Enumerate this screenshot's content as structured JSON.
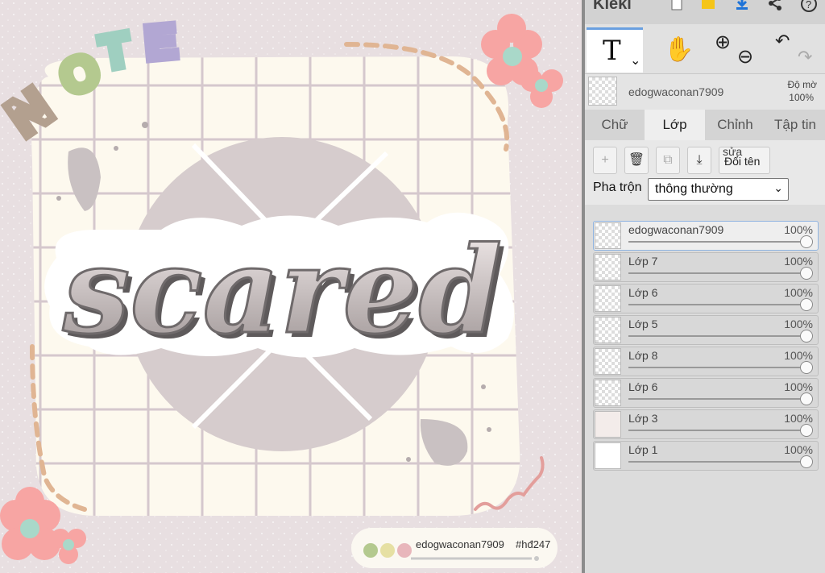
{
  "app": {
    "name": "Kleki"
  },
  "toolbar": {
    "icons": [
      "new-image-icon",
      "open-folder-icon",
      "download-icon",
      "share-icon",
      "help-icon"
    ],
    "tool_text_glyph": "T",
    "text_tool_dropdown": "⌄",
    "hand_glyph": "✋",
    "zoom_in": "⊕",
    "zoom_out": "⊖",
    "undo": "↶",
    "redo": "↷"
  },
  "current_layer": {
    "name": "edogwaconan7909",
    "opacity_label": "Độ mờ",
    "opacity": "100%"
  },
  "tabs": [
    {
      "label": "Chữ"
    },
    {
      "label": "Lớp",
      "active": true
    },
    {
      "label": "Chỉnh"
    },
    {
      "label": "Tập tin"
    }
  ],
  "layer_buttons": {
    "add": "+",
    "delete": "🗑",
    "duplicate": "⧉",
    "merge": "⤓",
    "rename_top": "sửa",
    "rename": "Đổi tên"
  },
  "blend": {
    "label": "Pha trộn",
    "value": "thông thường"
  },
  "layers": [
    {
      "name": "edogwaconan7909",
      "opacity": "100%",
      "opacity_value": 1.0,
      "selected": true
    },
    {
      "name": "Lớp 7",
      "opacity": "100%",
      "opacity_value": 1.0
    },
    {
      "name": "Lớp 6",
      "opacity": "100%",
      "opacity_value": 1.0
    },
    {
      "name": "Lớp 5",
      "opacity": "100%",
      "opacity_value": 1.0
    },
    {
      "name": "Lớp 8",
      "opacity": "100%",
      "opacity_value": 1.0
    },
    {
      "name": "Lớp 6",
      "opacity": "100%",
      "opacity_value": 1.0
    },
    {
      "name": "Lớp 3",
      "opacity": "100%",
      "opacity_value": 1.0
    },
    {
      "name": "Lớp 1",
      "opacity": "100%",
      "opacity_value": 1.0
    }
  ],
  "artwork": {
    "note_word": "NOTE",
    "note_letters": [
      "N",
      "O",
      "T",
      "E"
    ],
    "main_word": "scared",
    "watermark_name": "edogwaconan7909",
    "watermark_tag": "#hđ247",
    "colors": {
      "background": "#e8dfe1",
      "paper": "#fdf9ee",
      "grid": "#d5c8cd",
      "circle": "#d6cccd",
      "flower": "#f7a5a3",
      "flower_center": "#a9d8c9",
      "dash": "#e0b593",
      "note_n": "#b3a08f",
      "note_o": "#b4c98f",
      "note_t": "#9fcfc0",
      "note_e": "#b2a7d3"
    }
  }
}
